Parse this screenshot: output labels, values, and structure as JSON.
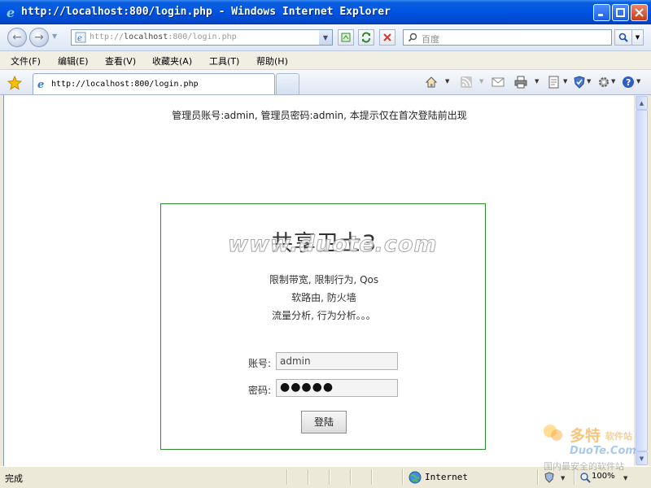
{
  "window": {
    "title": "http://localhost:800/login.php - Windows Internet Explorer"
  },
  "address_bar": {
    "prefix": "http://",
    "host": "localhost",
    "path": ":800/login.php"
  },
  "search": {
    "placeholder": "百度"
  },
  "menu": {
    "items": [
      "文件(F)",
      "编辑(E)",
      "查看(V)",
      "收藏夹(A)",
      "工具(T)",
      "帮助(H)"
    ]
  },
  "tab": {
    "label": "http://localhost:800/login.php"
  },
  "page": {
    "notice": "管理员账号:admin, 管理员密码:admin, 本提示仅在首次登陆前出现",
    "app_title": "共享卫士3",
    "watermark": "www.duote.com",
    "desc_lines": [
      "限制带宽, 限制行为, Qos",
      "软路由, 防火墙",
      "流量分析, 行为分析。。。"
    ],
    "account_label": "账号:",
    "account_value": "admin",
    "password_label": "密码:",
    "password_value": "●●●●●",
    "login_button": "登陆"
  },
  "status": {
    "text": "完成",
    "zone": "Internet",
    "zoom": "100%"
  },
  "corner_watermark": {
    "brand": "多特",
    "sub": "软件站",
    "site": "DuoTe.Com",
    "slogan": "国内最安全的软件站"
  },
  "colors": {
    "title_bar": "#0055e5",
    "login_border": "#2e8b2e",
    "close_button": "#c33d1c"
  }
}
